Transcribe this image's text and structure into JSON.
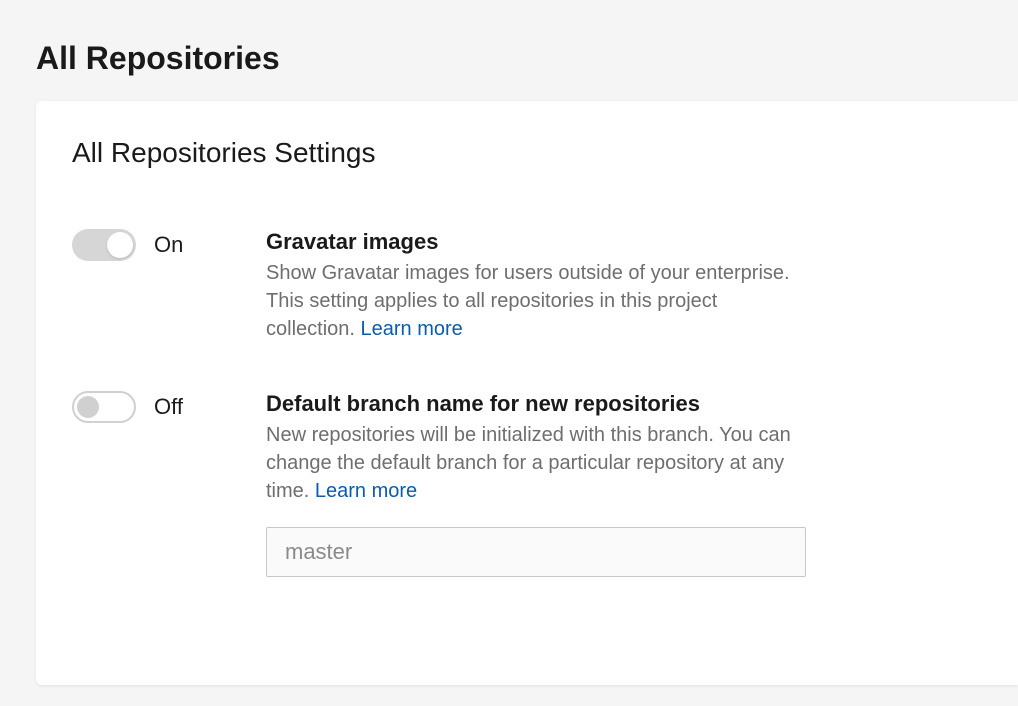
{
  "page": {
    "title": "All Repositories"
  },
  "card": {
    "title": "All Repositories Settings"
  },
  "settings": {
    "gravatar": {
      "toggle_state": "On",
      "title": "Gravatar images",
      "desc": "Show Gravatar images for users outside of your enterprise. This setting applies to all repositories in this project collection. ",
      "learn_more": "Learn more"
    },
    "default_branch": {
      "toggle_state": "Off",
      "title": "Default branch name for new repositories",
      "desc": "New repositories will be initialized with this branch. You can change the default branch for a particular repository at any time. ",
      "learn_more": "Learn more",
      "input_placeholder": "master",
      "input_value": ""
    }
  }
}
